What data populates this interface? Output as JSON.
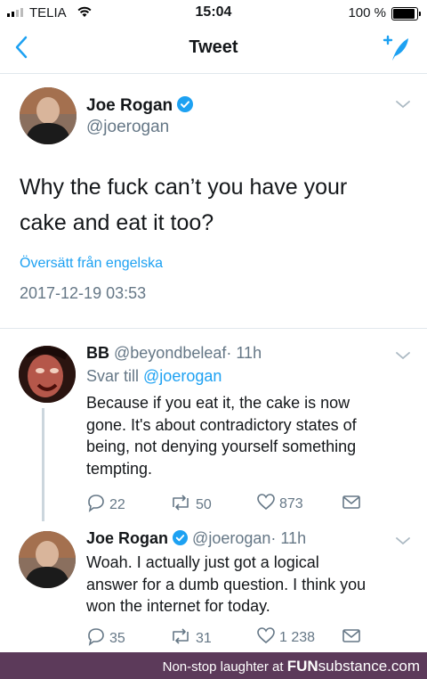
{
  "status_bar": {
    "carrier": "TELIA",
    "time": "15:04",
    "battery": "100 %"
  },
  "nav": {
    "title": "Tweet"
  },
  "main_tweet": {
    "name": "Joe Rogan",
    "handle": "@joerogan",
    "text_line1": "Why the fuck can’t you have your",
    "text_line2": "cake and eat it too?",
    "translate": "Översätt från engelska",
    "date": "2017-12-19 03:53"
  },
  "replies": [
    {
      "name": "BB",
      "handle": "@beyondbeleaf",
      "time": "· 11h",
      "reply_to_prefix": "Svar till",
      "reply_to": "@joerogan",
      "lines": [
        "Because if you eat it, the cake is now",
        "gone. It's about contradictory states of",
        "being, not denying yourself something",
        "tempting."
      ],
      "replies_count": "22",
      "retweets": "50",
      "likes": "873"
    },
    {
      "name": "Joe Rogan",
      "handle": "@joerogan",
      "time": "· 11h",
      "lines": [
        "Woah. I actually just got a logical",
        "answer for a dumb question. I think you",
        "won the internet for today."
      ],
      "replies_count": "35",
      "retweets": "31",
      "likes": "1 238"
    }
  ],
  "footer": {
    "tagline": "Non-stop laughter at",
    "brand_bold": "FUN",
    "brand_light": "substance",
    "brand_suffix": ".com"
  },
  "colors": {
    "accent": "#1da1f2",
    "footer_bg": "#5c3a5a"
  }
}
